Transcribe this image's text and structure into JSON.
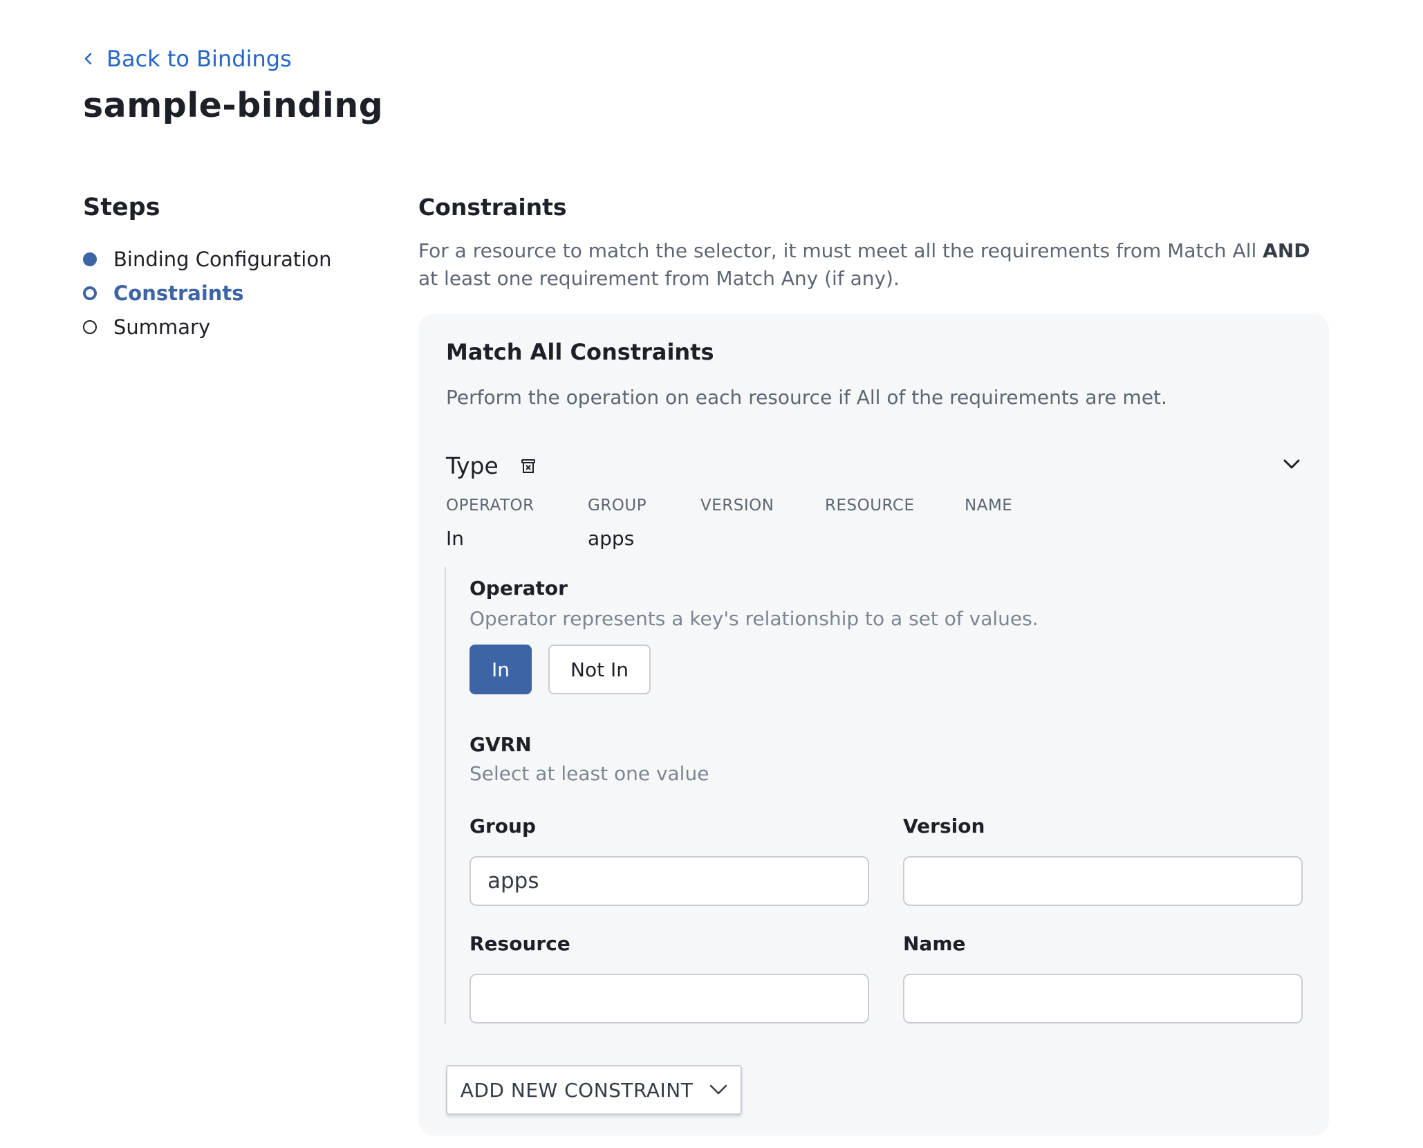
{
  "header": {
    "back_label": "Back to Bindings",
    "title": "sample-binding"
  },
  "steps": {
    "title": "Steps",
    "items": [
      {
        "label": "Binding Configuration",
        "state": "done"
      },
      {
        "label": "Constraints",
        "state": "active"
      },
      {
        "label": "Summary",
        "state": "pending"
      }
    ]
  },
  "constraints": {
    "title": "Constraints",
    "desc_before": "For a resource to match the selector, it must meet all the requirements from Match All ",
    "desc_bold": "AND",
    "desc_after": " at least one requirement from Match Any (if any).",
    "card": {
      "title": "Match All Constraints",
      "desc": "Perform the operation on each resource if All of the requirements are met.",
      "type_label": "Type",
      "columns": {
        "operator": "OPERATOR",
        "group": "GROUP",
        "version": "VERSION",
        "resource": "RESOURCE",
        "name": "NAME"
      },
      "values": {
        "operator": "In",
        "group": "apps",
        "version": "",
        "resource": "",
        "name": ""
      },
      "operator": {
        "title": "Operator",
        "desc": "Operator represents a key's relationship to a set of values.",
        "options": [
          "In",
          "Not In"
        ],
        "selected": "In"
      },
      "gvrn": {
        "title": "GVRN",
        "desc": "Select at least one value",
        "group_label": "Group",
        "group_value": "apps",
        "version_label": "Version",
        "version_value": "",
        "resource_label": "Resource",
        "resource_value": "",
        "name_label": "Name",
        "name_value": ""
      },
      "add_button": "ADD NEW CONSTRAINT"
    }
  },
  "colors": {
    "accent": "#3d64a4",
    "link": "#2666c7",
    "card_bg": "#f6f7f9"
  }
}
